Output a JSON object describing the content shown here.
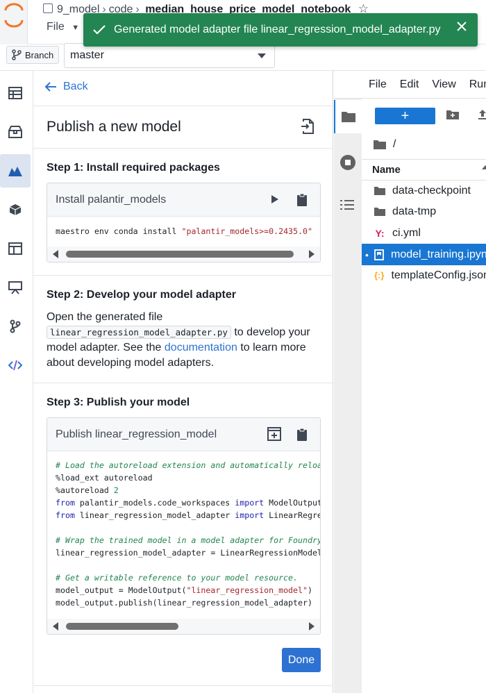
{
  "breadcrumb": {
    "project": "9_model",
    "folder": "code",
    "current": "median_house_price_model_notebook"
  },
  "file_menu_label": "File",
  "branch": {
    "tag_label": "Branch",
    "selected": "master"
  },
  "toast": {
    "message": "Generated model adapter file linear_regression_model_adapter.py",
    "color": "#238551"
  },
  "panel": {
    "back_label": "Back",
    "title": "Publish a new model",
    "step1": {
      "title": "Step 1: Install required packages",
      "box_title": "Install palantir_models",
      "code_cmd": "maestro env conda install ",
      "code_arg": "\"palantir_models>=0.2435.0\""
    },
    "step2": {
      "title": "Step 2: Develop your model adapter",
      "text_a": "Open the generated file",
      "file_name": "linear_regression_model_adapter.py",
      "text_b": " to develop your model adapter. See the ",
      "link": "documentation",
      "text_c": " to learn more about developing model adapters."
    },
    "step3": {
      "title": "Step 3: Publish your model",
      "box_title": "Publish linear_regression_model",
      "code": {
        "c1": "# Load the autoreload extension and automatically reload",
        "l2": "%load_ext autoreload",
        "l3a": "%autoreload ",
        "l3b": "2",
        "l4a": "from",
        "l4b": " palantir_models.code_workspaces ",
        "l4c": "import",
        "l4d": " ModelOutput",
        "l5a": "from",
        "l5b": " linear_regression_model_adapter ",
        "l5c": "import",
        "l5d": " LinearRegressionModelAdapter",
        "c2": "# Wrap the trained model in a model adapter for Foundry",
        "l7": "linear_regression_model_adapter = LinearRegressionModelAdapter(model)",
        "c3": "# Get a writable reference to your model resource.",
        "l9a": "model_output = ModelOutput(",
        "l9b": "\"linear_regression_model\"",
        "l9c": ")",
        "l10": "model_output.publish(linear_regression_model_adapter)"
      }
    },
    "done_label": "Done"
  },
  "jupyter": {
    "menu": [
      "File",
      "Edit",
      "View",
      "Run"
    ],
    "path_root": "/",
    "name_header": "Name",
    "files": [
      {
        "name": "data-checkpoint",
        "icon": "folder-icon"
      },
      {
        "name": "data-tmp",
        "icon": "folder-icon"
      },
      {
        "name": "ci.yml",
        "icon": "yaml-icon"
      },
      {
        "name": "model_training.ipynb",
        "icon": "notebook-icon",
        "selected": true
      },
      {
        "name": "templateConfig.json",
        "icon": "json-icon"
      }
    ],
    "accent": "#1976d2"
  }
}
